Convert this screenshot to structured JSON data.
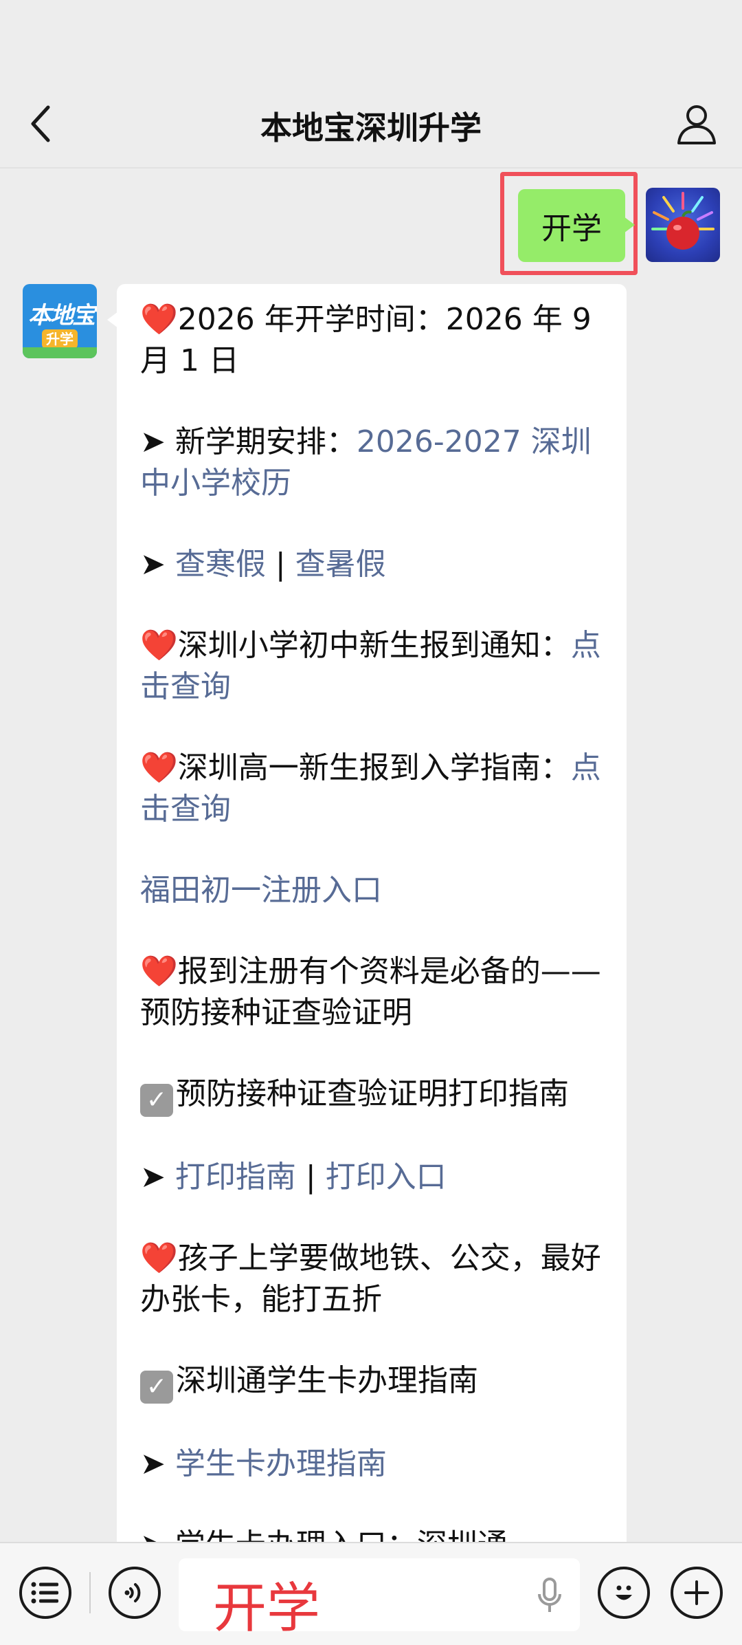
{
  "header": {
    "title": "本地宝深圳升学"
  },
  "my_message": {
    "text": "开学"
  },
  "bot_avatar": {
    "logo_top": "本地宝",
    "logo_badge": "升学"
  },
  "bot_message": {
    "p1": {
      "prefix": "❤️",
      "text": "2026 年开学时间：2026 年 9 月 1 日"
    },
    "p2": {
      "prefix": "➤ ",
      "label": "新学期安排：",
      "link": "2026-2027 深圳中小学校历"
    },
    "p3": {
      "prefix": "➤ ",
      "link1": "查寒假",
      "sep": " | ",
      "link2": "查暑假"
    },
    "p4": {
      "prefix": "❤️",
      "text": "深圳小学初中新生报到通知：",
      "link": "点击查询"
    },
    "p5": {
      "prefix": "❤️",
      "text": "深圳高一新生报到入学指南：",
      "link": "点击查询"
    },
    "p6": {
      "link": "福田初一注册入口"
    },
    "p7": {
      "prefix": "❤️",
      "text": "报到注册有个资料是必备的——预防接种证查验证明"
    },
    "p8": {
      "check": "✓",
      "text": "预防接种证查验证明打印指南"
    },
    "p9": {
      "prefix": "➤ ",
      "link1": "打印指南",
      "sep": " | ",
      "link2": "打印入口"
    },
    "p10": {
      "prefix": "❤️",
      "text": "孩子上学要做地铁、公交，最好办张卡，能打五折"
    },
    "p11": {
      "check": "✓",
      "text": "深圳通学生卡办理指南"
    },
    "p12": {
      "prefix": "➤ ",
      "link": "学生卡办理指南"
    },
    "p13": {
      "prefix": "➤ ",
      "text": "学生卡办理入口：深圳通"
    }
  },
  "input_bar": {
    "value": "开学"
  },
  "icons": [
    "back-icon",
    "person-icon",
    "list-icon",
    "voice-icon",
    "mic-icon",
    "emoji-icon",
    "plus-icon"
  ],
  "colors": {
    "my_bubble": "#95ec69",
    "link": "#576b95",
    "highlight": "#f0505a",
    "input_text": "#e8383d"
  }
}
